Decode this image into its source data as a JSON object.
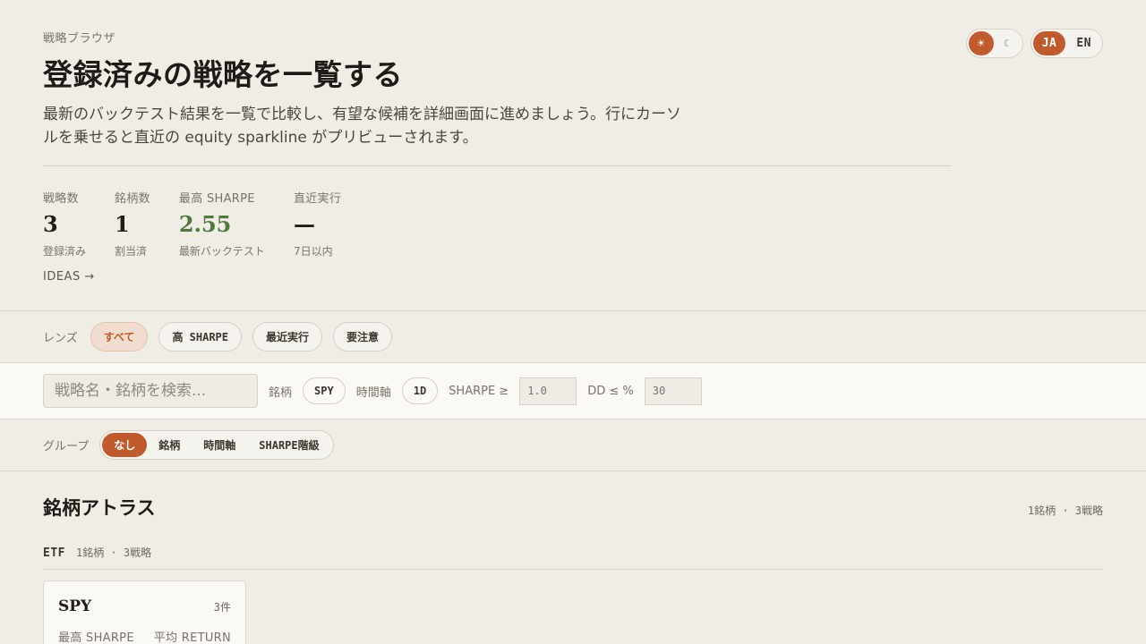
{
  "header": {
    "eyebrow": "戦略ブラウザ",
    "title": "登録済みの戦略を一覧する",
    "lead": "最新のバックテスト結果を一覧で比較し、有望な候補を詳細画面に進めましょう。行にカーソルを乗せると直近の equity sparkline がプリビューされます。"
  },
  "toggles": {
    "theme_light": "☀",
    "theme_dark": "☾",
    "lang_ja": "JA",
    "lang_en": "EN"
  },
  "stats": [
    {
      "label": "戦略数",
      "value": "3",
      "sub": "登録済み"
    },
    {
      "label": "銘柄数",
      "value": "1",
      "sub": "割当済"
    },
    {
      "label": "最高 SHARPE",
      "value": "2.55",
      "sub": "最新バックテスト"
    },
    {
      "label": "直近実行",
      "value": "—",
      "sub": "7日以内"
    }
  ],
  "ideas_link": "IDEAS →",
  "lens": {
    "label": "レンズ",
    "chips": [
      "すべて",
      "高 SHARPE",
      "最近実行",
      "要注意"
    ]
  },
  "filters": {
    "search_placeholder": "戦略名・銘柄を検索...",
    "symbol_label": "銘柄",
    "symbol_value": "SPY",
    "timeframe_label": "時間軸",
    "timeframe_value": "1D",
    "sharpe_label": "SHARPE ≥",
    "sharpe_placeholder": "1.0",
    "dd_label": "DD ≤ %",
    "dd_placeholder": "30"
  },
  "group": {
    "label": "グループ",
    "options": [
      "なし",
      "銘柄",
      "時間軸",
      "SHARPE階級"
    ]
  },
  "atlas": {
    "title": "銘柄アトラス",
    "meta": "1銘柄 · 3戦略",
    "etf_label": "ETF",
    "etf_meta": "1銘柄 · 3戦略",
    "card": {
      "symbol": "SPY",
      "count": "3件",
      "col1": "最高 SHARPE",
      "col2": "平均 RETURN"
    }
  },
  "colors": {
    "accent": "#c05a2c",
    "positive": "#4e7a3c",
    "background": "#f0ede7"
  }
}
